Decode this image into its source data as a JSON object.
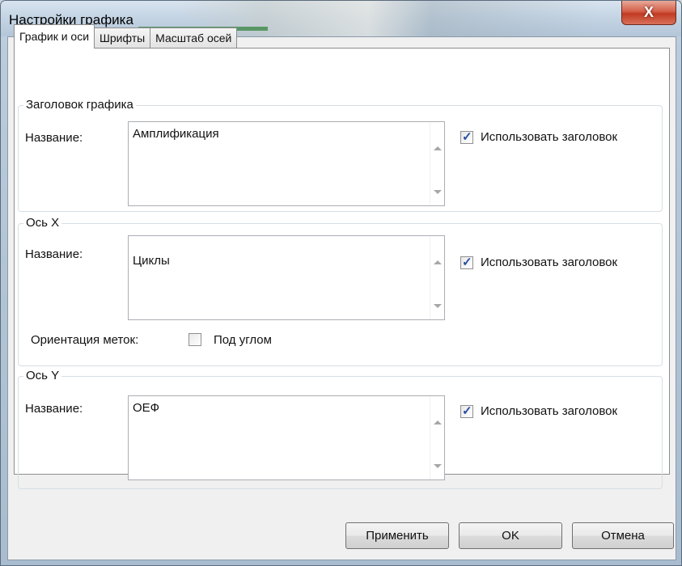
{
  "window": {
    "title": "Настройки графика",
    "close_glyph": "X"
  },
  "tabs": [
    {
      "label": "График и оси"
    },
    {
      "label": "Шрифты"
    },
    {
      "label": "Масштаб осей"
    }
  ],
  "groups": {
    "chart_title": {
      "legend": "Заголовок графика",
      "name_label": "Название:",
      "value": "Амплификация",
      "use_title_label": "Использовать заголовок",
      "use_title_checked": true
    },
    "x_axis": {
      "legend": "Ось X",
      "name_label": "Название:",
      "value": "Циклы",
      "use_title_label": "Использовать заголовок",
      "use_title_checked": true,
      "orientation_label": "Ориентация меток:",
      "angle_label": "Под углом",
      "angle_checked": false
    },
    "y_axis": {
      "legend": "Ось Y",
      "name_label": "Название:",
      "value": "ОЕФ",
      "use_title_label": "Использовать заголовок",
      "use_title_checked": true
    }
  },
  "buttons": {
    "apply": "Применить",
    "ok": "OK",
    "cancel": "Отмена"
  },
  "icons": {
    "check": "✓"
  },
  "colors": {
    "check": "#274ea0",
    "close": "#c13a22"
  }
}
